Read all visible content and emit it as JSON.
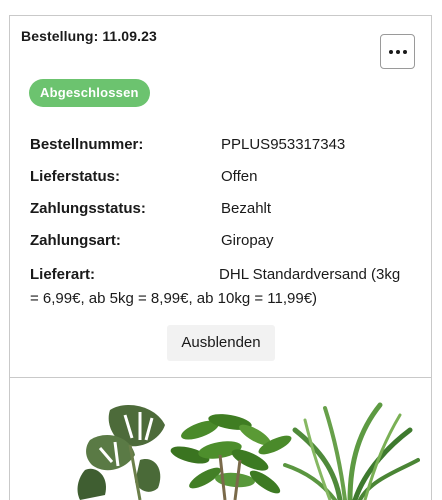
{
  "order": {
    "title": "Bestellung: 11.09.23",
    "status_badge": "Abgeschlossen",
    "more_menu_icon": "more-horizontal-icon"
  },
  "details": [
    {
      "label": "Bestellnummer:",
      "value": "PPLUS953317343"
    },
    {
      "label": "Lieferstatus:",
      "value": "Offen"
    },
    {
      "label": "Zahlungsstatus:",
      "value": "Bezahlt"
    },
    {
      "label": "Zahlungsart:",
      "value": "Giropay"
    }
  ],
  "delivery": {
    "label": "Lieferart:",
    "value": "DHL Standardversand (3kg = 6,99€, ab 5kg = 8,99€, ab 10kg = 11,99€)"
  },
  "actions": {
    "hide_label": "Ausblenden"
  },
  "product": {
    "image_description_icon": "plant-image"
  },
  "colors": {
    "badge_green": "#6cc36f",
    "border": "#c9c9c9",
    "button_bg": "#f2f2f2"
  }
}
